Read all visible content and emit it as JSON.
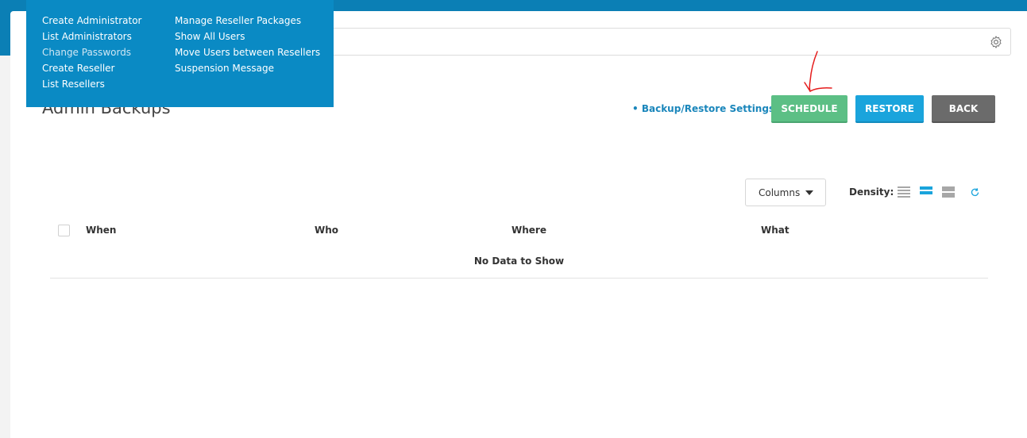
{
  "admin_menu": {
    "left_column": [
      {
        "label": "Create Administrator"
      },
      {
        "label": "List Administrators"
      },
      {
        "label": "Change Passwords"
      },
      {
        "label": "Create Reseller"
      },
      {
        "label": "List Resellers"
      }
    ],
    "right_column": [
      {
        "label": "Manage Reseller Packages"
      },
      {
        "label": "Show All Users"
      },
      {
        "label": "Move Users between Resellers"
      },
      {
        "label": "Suspension Message"
      }
    ]
  },
  "search": {
    "placeholder": "",
    "icon": "gear-icon"
  },
  "page": {
    "title": "Admin Backups"
  },
  "toolbar": {
    "settings_link": "• Backup/Restore Settings",
    "schedule_label": "SCHEDULE",
    "restore_label": "RESTORE",
    "back_label": "BACK"
  },
  "table_controls": {
    "columns_label": "Columns",
    "density_label": "Density:",
    "selected_density": "normal"
  },
  "table": {
    "columns": [
      "When",
      "Who",
      "Where",
      "What"
    ],
    "empty_message": "No Data to Show"
  },
  "colors": {
    "header": "#0b7fb5",
    "menu": "#0a8ac4",
    "schedule": "#5cbf85",
    "restore": "#1aa4dc",
    "back": "#6b6b6b",
    "link": "#1a86bb"
  }
}
